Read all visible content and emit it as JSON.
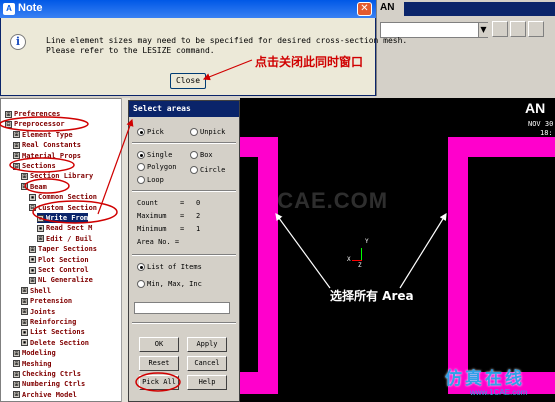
{
  "note": {
    "title": "Note",
    "message": "Line element sizes may need to be specified for desired cross-section mesh.\nPlease refer to the LESIZE command.",
    "close_label": "Close",
    "annotation": "点击关闭此同时窗口"
  },
  "app": {
    "logo": "AN"
  },
  "tree": {
    "items": [
      {
        "label": "Preferences",
        "expander": "⊞",
        "indent": 0
      },
      {
        "label": "Preprocessor",
        "expander": "⊟",
        "indent": 0
      },
      {
        "label": "Element Type",
        "expander": "⊞",
        "indent": 1
      },
      {
        "label": "Real Constants",
        "expander": "⊞",
        "indent": 1
      },
      {
        "label": "Material Props",
        "expander": "⊞",
        "indent": 1
      },
      {
        "label": "Sections",
        "expander": "⊟",
        "indent": 1
      },
      {
        "label": "Section Library",
        "expander": "⊞",
        "indent": 2
      },
      {
        "label": "Beam",
        "expander": "⊟",
        "indent": 2
      },
      {
        "label": "Common Section",
        "expander": "▪",
        "indent": 3
      },
      {
        "label": "Custom Section",
        "expander": "⊟",
        "indent": 3
      },
      {
        "label": "Write From",
        "expander": "▪",
        "indent": 4,
        "selected": true
      },
      {
        "label": "Read Sect M",
        "expander": "▪",
        "indent": 4
      },
      {
        "label": "Edit / Buil",
        "expander": "⊞",
        "indent": 4
      },
      {
        "label": "Taper Sections",
        "expander": "⊞",
        "indent": 3
      },
      {
        "label": "Plot Section",
        "expander": "▪",
        "indent": 3
      },
      {
        "label": "Sect Control",
        "expander": "▪",
        "indent": 3
      },
      {
        "label": "NL Generalize",
        "expander": "⊞",
        "indent": 3
      },
      {
        "label": "Shell",
        "expander": "⊞",
        "indent": 2
      },
      {
        "label": "Pretension",
        "expander": "⊞",
        "indent": 2
      },
      {
        "label": "Joints",
        "expander": "⊞",
        "indent": 2
      },
      {
        "label": "Reinforcing",
        "expander": "⊞",
        "indent": 2
      },
      {
        "label": "List Sections",
        "expander": "▪",
        "indent": 2
      },
      {
        "label": "Delete Section",
        "expander": "▪",
        "indent": 2
      },
      {
        "label": "Modeling",
        "expander": "⊞",
        "indent": 1
      },
      {
        "label": "Meshing",
        "expander": "⊞",
        "indent": 1
      },
      {
        "label": "Checking Ctrls",
        "expander": "⊞",
        "indent": 1
      },
      {
        "label": "Numbering Ctrls",
        "expander": "⊞",
        "indent": 1
      },
      {
        "label": "Archive Model",
        "expander": "⊞",
        "indent": 1
      }
    ]
  },
  "select": {
    "title": "Select areas",
    "pick": "Pick",
    "unpick": "Unpick",
    "single": "Single",
    "box": "Box",
    "polygon": "Polygon",
    "circle": "Circle",
    "loop": "Loop",
    "count_label": "Count",
    "count": "0",
    "max_label": "Maximum",
    "max": "2",
    "min_label": "Minimum",
    "min": "1",
    "area_no_label": "Area No. =",
    "list_items": "List of Items",
    "min_max_inc": "Min, Max, Inc",
    "ok": "OK",
    "apply": "Apply",
    "reset": "Reset",
    "cancel": "Cancel",
    "pick_all": "Pick All",
    "help": "Help"
  },
  "graphics": {
    "logo": "AN",
    "date": "NOV 30",
    "time": "18:",
    "annotation": "选择所有 Area",
    "watermark": "1CAE.COM",
    "triad_y": "Y",
    "triad_x": "X",
    "triad_z": "Z"
  },
  "branding": {
    "name": "仿真在线",
    "url": "www.1CAE.com"
  },
  "colors": {
    "beam": "#ff00cc",
    "annotation_red": "#d00000",
    "title_blue": "#0a246a"
  }
}
